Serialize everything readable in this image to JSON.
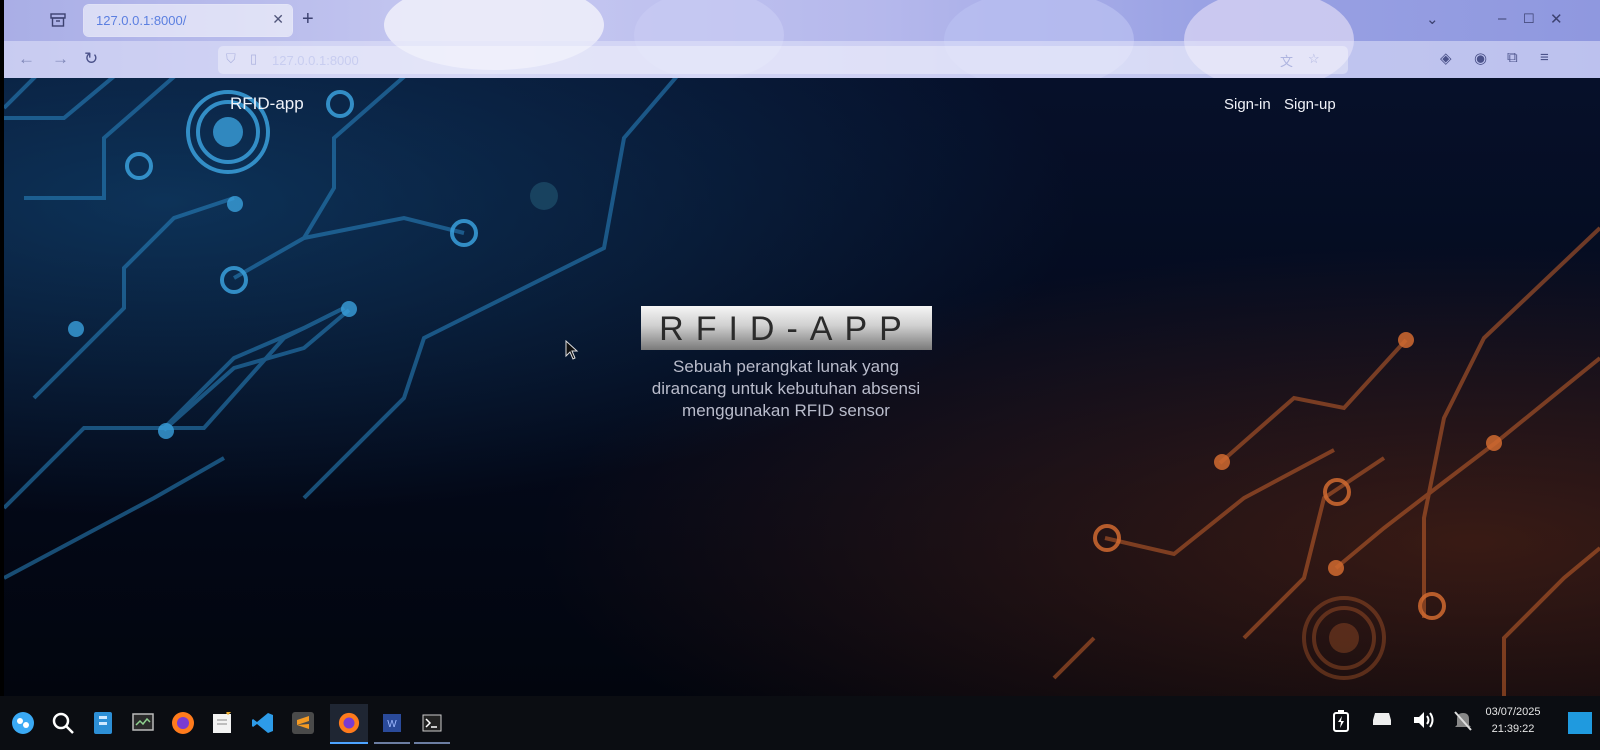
{
  "browser": {
    "tab": {
      "title": "127.0.0.1:8000/"
    },
    "address": {
      "url": "127.0.0.1:8000"
    }
  },
  "site": {
    "brand": "RFID-app",
    "nav": {
      "signin": "Sign-in",
      "signup": "Sign-up"
    },
    "hero": {
      "title": "RFID-APP",
      "subtitle_lines": [
        "Sebuah perangkat lunak yang",
        "dirancang untuk kebutuhan absensi",
        "menggunakan RFID sensor"
      ]
    }
  },
  "taskbar": {
    "apps": [
      "launcher-icon",
      "search-icon",
      "file-manager-icon",
      "monitor-icon",
      "firefox-icon",
      "notes-icon",
      "vscode-icon",
      "sublime-text-icon",
      "firefox-icon",
      "word-icon",
      "terminal-icon"
    ],
    "clock": {
      "date": "03/07/2025",
      "time": "21:39:22"
    }
  }
}
